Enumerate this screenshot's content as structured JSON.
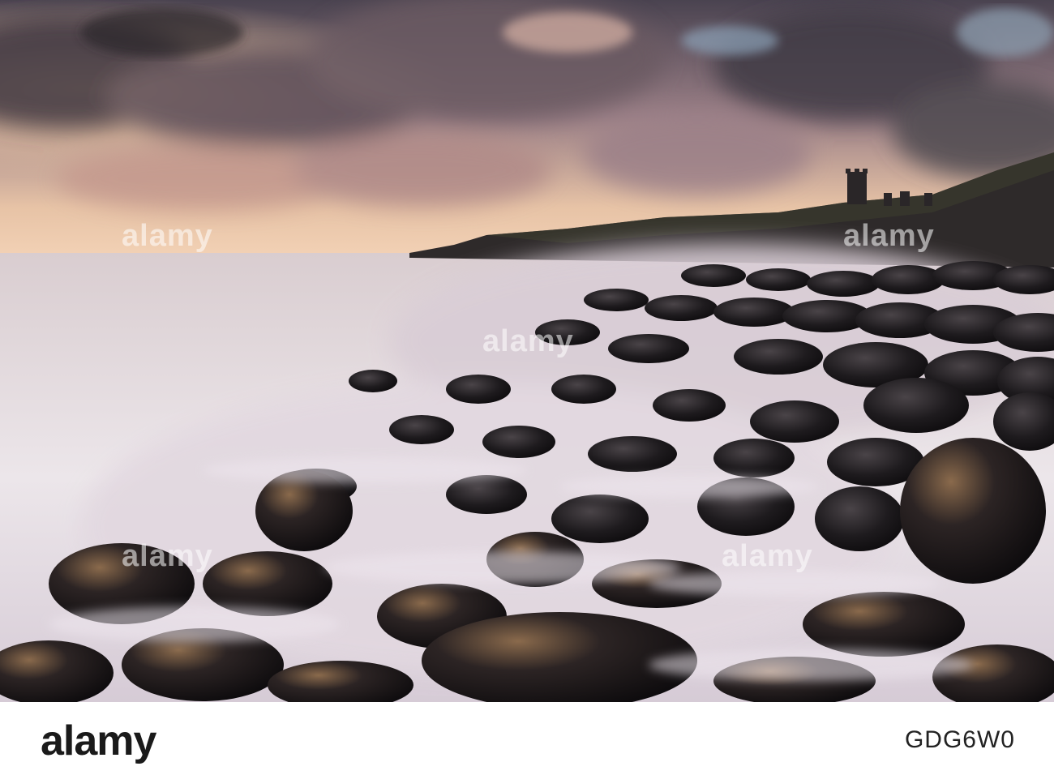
{
  "watermark": {
    "text": "alamy"
  },
  "footer": {
    "logo": "alamy",
    "image_code": "GDG6W0"
  }
}
